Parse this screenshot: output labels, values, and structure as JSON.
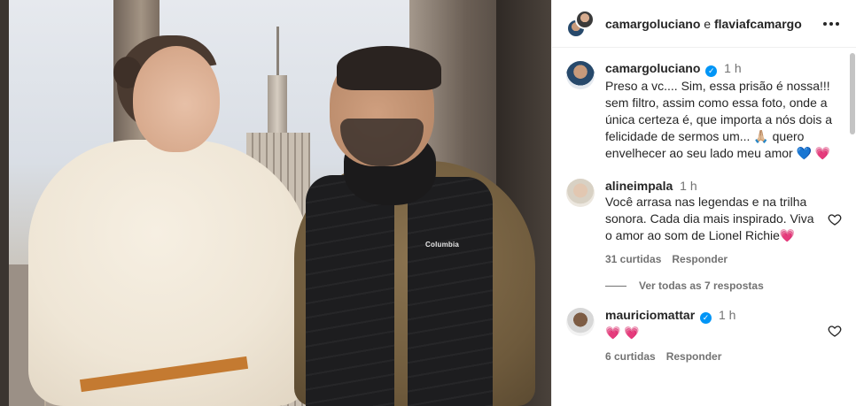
{
  "header": {
    "user1": "camargoluciano",
    "connector": "e",
    "user2": "flaviafcamargo"
  },
  "caption": {
    "username": "camargoluciano",
    "verified": true,
    "time": "1 h",
    "text": "Preso a vc.... Sim, essa prisão é nossa!!! sem filtro, assim como essa foto, onde a única certeza é, que importa a nós dois a felicidade de sermos um... 🙏🏼 quero envelhecer ao seu lado meu amor",
    "emojis": [
      "💙",
      "💗"
    ]
  },
  "comments": [
    {
      "username": "alineimpala",
      "verified": false,
      "time": "1 h",
      "text": "Você arrasa nas legendas e na trilha sonora. Cada dia mais inspirado. Viva o amor ao som de Lionel Richie",
      "emoji": "💗",
      "likes": "31 curtidas",
      "reply": "Responder",
      "view_replies": "Ver todas as 7 respostas"
    },
    {
      "username": "mauriciomattar",
      "verified": true,
      "time": "1 h",
      "text": "💗 💗",
      "likes": "6 curtidas",
      "reply": "Responder"
    }
  ],
  "photo": {
    "brand_label": "Columbia"
  },
  "colors": {
    "verified": "#0095f6",
    "secondary_text": "#737373",
    "heart": "#e0245e"
  }
}
